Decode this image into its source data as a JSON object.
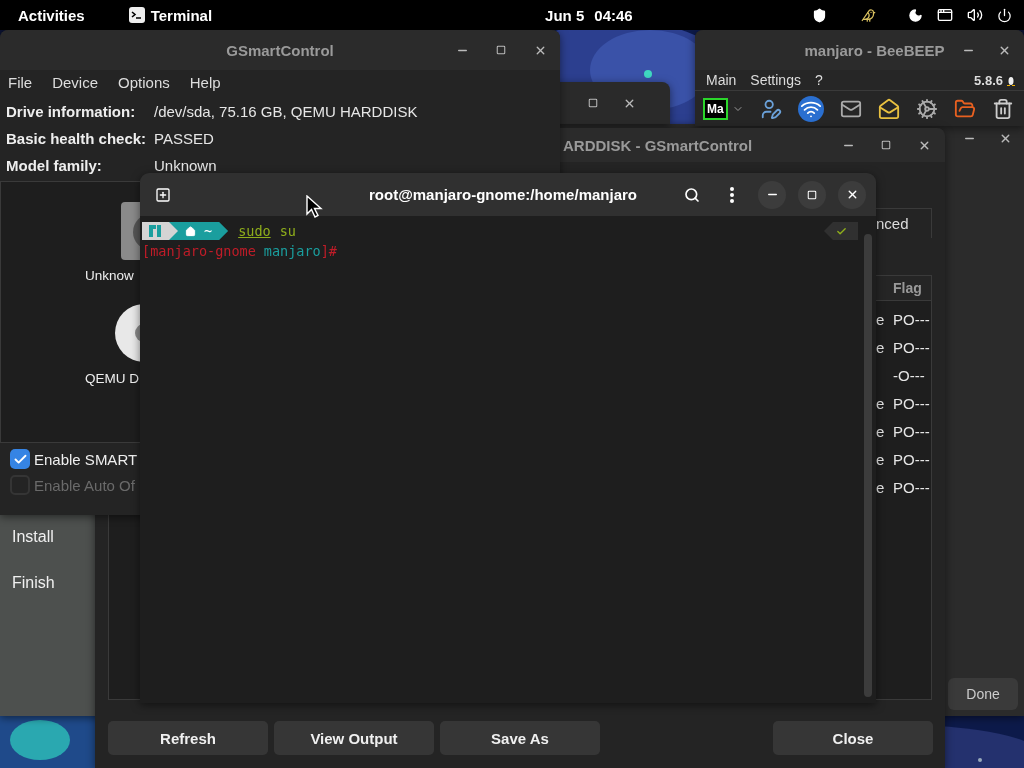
{
  "top_bar": {
    "activities": "Activities",
    "app_menu": "Terminal",
    "date": "Jun 5",
    "time": "04:46"
  },
  "installer": {
    "steps": [
      {
        "label": "Install"
      },
      {
        "label": "Finish"
      }
    ],
    "done_button": "Done"
  },
  "beebeep": {
    "title": "manjaro - BeeBEEP",
    "menu": [
      "Main",
      "Settings",
      "?"
    ],
    "version": "5.8.6",
    "status": "Ma"
  },
  "smart_details": {
    "title": "ARDDISK - GSmartControl",
    "tab": "nced",
    "table": {
      "columns": [
        "Flag"
      ],
      "rows": [
        {
          "column_1": "e",
          "flags": "PO---"
        },
        {
          "column_1": "e",
          "flags": "PO---"
        },
        {
          "flags": "-O---"
        },
        {
          "column_1": "e",
          "flags": "PO---"
        },
        {
          "column_1": "e",
          "flags": "PO---"
        },
        {
          "column_1": "e",
          "flags": "PO---"
        },
        {
          "column_1": "e",
          "flags": "PO---"
        }
      ]
    },
    "buttons": [
      "Refresh",
      "View Output",
      "Save As"
    ],
    "close_button": "Close"
  },
  "gsmartcontrol": {
    "title": "GSmartControl",
    "menu": [
      "File",
      "Device",
      "Options",
      "Help"
    ],
    "info": [
      {
        "label": "Drive information:",
        "value": "/dev/sda, 75.16 GB, QEMU HARDDISK"
      },
      {
        "label": "Basic health check:",
        "value": "PASSED"
      },
      {
        "label": "Model family:",
        "value": "Unknown"
      }
    ],
    "drives": [
      {
        "label": "Unknow",
        "kind": "hdd"
      },
      {
        "label": "QEMU D",
        "kind": "optical"
      }
    ],
    "options": [
      {
        "label": "Enable SMART",
        "checked": true,
        "disabled": false
      },
      {
        "label": "Enable Auto Of",
        "checked": false,
        "disabled": true
      }
    ]
  },
  "terminal": {
    "title": "root@manjaro-gnome:/home/manjaro",
    "prompt": {
      "home": "~",
      "command": "sudo",
      "argument": "su"
    },
    "output": [
      {
        "text": "[manjaro-gnome",
        "color": "#c01c28"
      },
      {
        "text": "manjaro",
        "color": "#1a9e9e"
      },
      {
        "text": "]#",
        "color": "#c01c28"
      }
    ]
  }
}
